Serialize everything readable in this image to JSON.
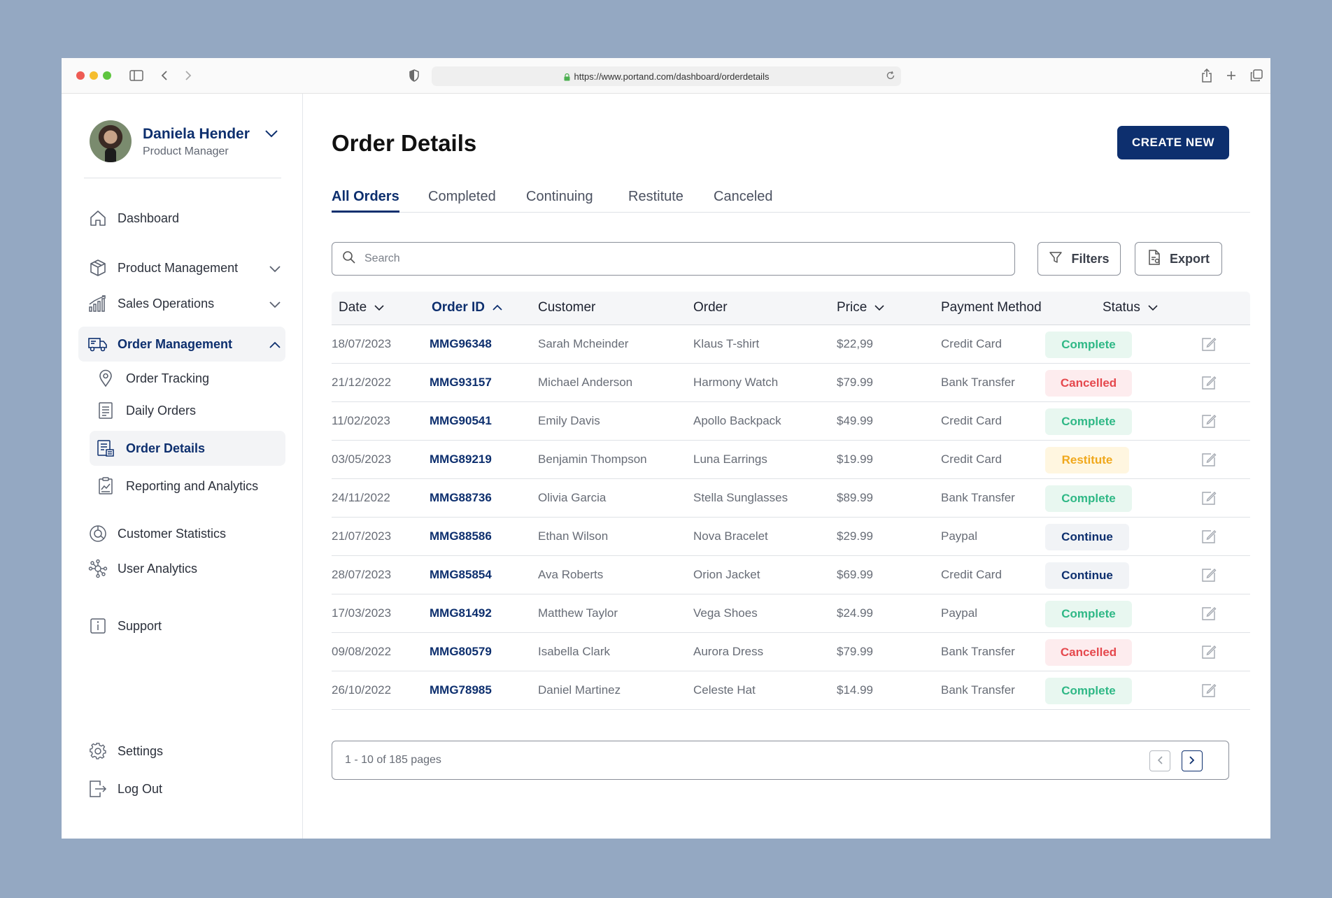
{
  "browser": {
    "url": "https://www.portand.com/dashboard/orderdetails"
  },
  "profile": {
    "name": "Daniela Hender",
    "role": "Product Manager"
  },
  "sidebar": {
    "dashboard": "Dashboard",
    "product_management": "Product Management",
    "sales_operations": "Sales Operations",
    "order_management": "Order Management",
    "order_tracking": "Order Tracking",
    "daily_orders": "Daily Orders",
    "order_details": "Order Details",
    "reporting": "Reporting and Analytics",
    "customer_statistics": "Customer Statistics",
    "user_analytics": "User Analytics",
    "support": "Support",
    "settings": "Settings",
    "logout": "Log Out"
  },
  "main": {
    "title": "Order Details",
    "create_label": "CREATE NEW",
    "tabs": [
      "All Orders",
      "Completed",
      "Continuing",
      "Restitute",
      "Canceled"
    ],
    "search_placeholder": "Search",
    "filters_label": "Filters",
    "export_label": "Export"
  },
  "table": {
    "headers": [
      "Date",
      "Order ID",
      "Customer",
      "Order",
      "Price",
      "Payment Method",
      "Status"
    ],
    "rows": [
      {
        "date": "18/07/2023",
        "id": "MMG96348",
        "customer": "Sarah Mcheinder",
        "order": "Klaus T-shirt",
        "price": "$22,99",
        "payment": "Credit Card",
        "status": "Complete"
      },
      {
        "date": "21/12/2022",
        "id": "MMG93157",
        "customer": "Michael Anderson",
        "order": "Harmony Watch",
        "price": "$79.99",
        "payment": "Bank Transfer",
        "status": "Cancelled"
      },
      {
        "date": "11/02/2023",
        "id": "MMG90541",
        "customer": "Emily Davis",
        "order": "Apollo Backpack",
        "price": "$49.99",
        "payment": "Credit Card",
        "status": "Complete"
      },
      {
        "date": "03/05/2023",
        "id": "MMG89219",
        "customer": "Benjamin Thompson",
        "order": "Luna Earrings",
        "price": "$19.99",
        "payment": "Credit Card",
        "status": "Restitute"
      },
      {
        "date": "24/11/2022",
        "id": "MMG88736",
        "customer": "Olivia Garcia",
        "order": "Stella Sunglasses",
        "price": "$89.99",
        "payment": "Bank Transfer",
        "status": "Complete"
      },
      {
        "date": "21/07/2023",
        "id": "MMG88586",
        "customer": "Ethan Wilson",
        "order": "Nova Bracelet",
        "price": "$29.99",
        "payment": "Paypal",
        "status": "Continue"
      },
      {
        "date": "28/07/2023",
        "id": "MMG85854",
        "customer": "Ava Roberts",
        "order": "Orion Jacket",
        "price": "$69.99",
        "payment": "Credit Card",
        "status": "Continue"
      },
      {
        "date": "17/03/2023",
        "id": "MMG81492",
        "customer": "Matthew Taylor",
        "order": "Vega Shoes",
        "price": "$24.99",
        "payment": "Paypal",
        "status": "Complete"
      },
      {
        "date": "09/08/2022",
        "id": "MMG80579",
        "customer": "Isabella Clark",
        "order": "Aurora Dress",
        "price": "$79.99",
        "payment": "Bank Transfer",
        "status": "Cancelled"
      },
      {
        "date": "26/10/2022",
        "id": "MMG78985",
        "customer": "Daniel Martinez",
        "order": "Celeste Hat",
        "price": "$14.99",
        "payment": "Bank Transfer",
        "status": "Complete"
      }
    ]
  },
  "status_colors": {
    "Complete": {
      "bg": "#e8f7f0",
      "fg": "#2fb886"
    },
    "Cancelled": {
      "bg": "#fdecee",
      "fg": "#e5484d"
    },
    "Restitute": {
      "bg": "#fff6e0",
      "fg": "#f0a81c"
    },
    "Continue": {
      "bg": "#f1f3f6",
      "fg": "#0d2f6e"
    }
  },
  "pagination": {
    "text": "1 - 10 of 185 pages"
  },
  "colors": {
    "accent": "#0d2f6e",
    "backdrop": "#94a8c2"
  }
}
